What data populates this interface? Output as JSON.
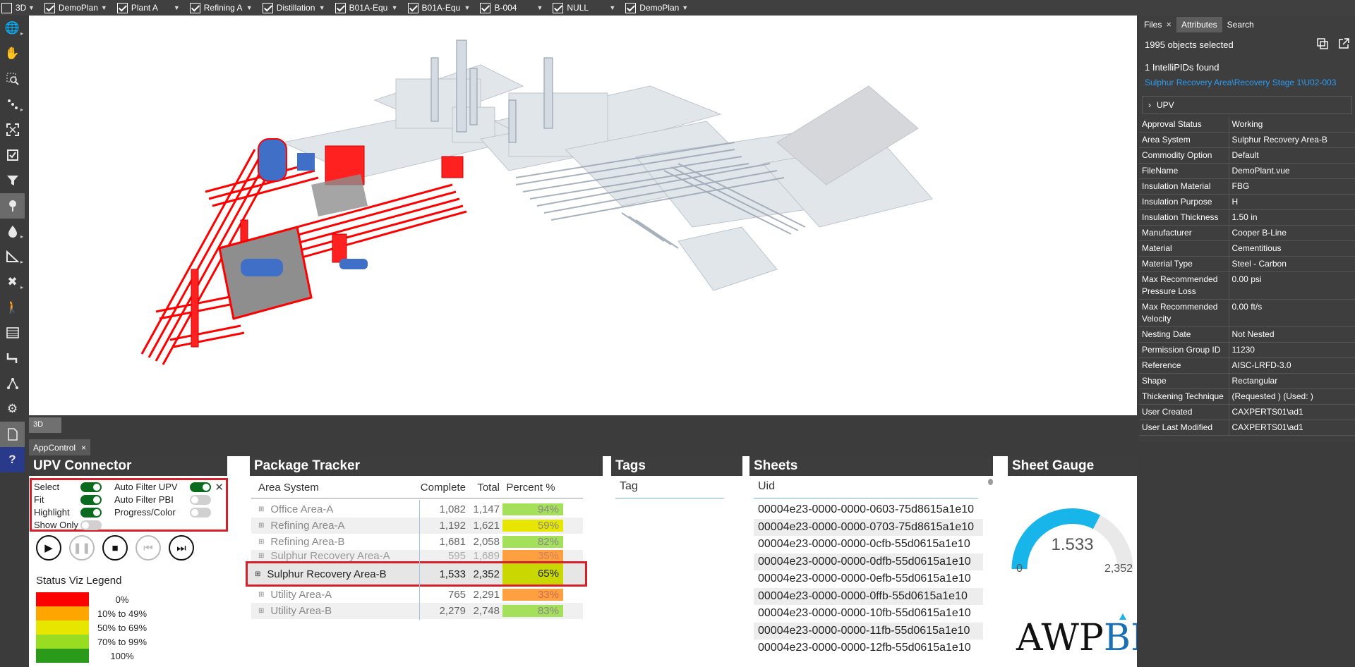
{
  "filters": [
    {
      "label": "3D",
      "checked": false
    },
    {
      "label": "DemoPlan",
      "checked": true
    },
    {
      "label": "Plant A",
      "checked": true
    },
    {
      "label": "Refining A",
      "checked": true
    },
    {
      "label": "Distillation",
      "checked": true
    },
    {
      "label": "B01A-Equ",
      "checked": true
    },
    {
      "label": "B01A-Equ",
      "checked": true
    },
    {
      "label": "B-004",
      "checked": true
    },
    {
      "label": "NULL",
      "checked": true
    },
    {
      "label": "DemoPlan",
      "checked": true
    }
  ],
  "toolbar": {
    "icons": [
      "globe-icon",
      "hand-pan-icon",
      "zoom-window-icon",
      "explode-icon",
      "fit-screen-icon",
      "checkbox-icon",
      "filter-icon",
      "pin-icon",
      "color-drop-icon",
      "measure-icon",
      "tools-icon",
      "walk-icon",
      "table-icon",
      "route-icon",
      "network-icon",
      "settings-icon",
      "document-icon",
      "help-icon"
    ],
    "help_label": "?"
  },
  "viewport": {
    "tab_label": "3D"
  },
  "right_panel": {
    "tabs": [
      {
        "label": "Files",
        "closable": true
      },
      {
        "label": "Attributes",
        "closable": false
      },
      {
        "label": "Search",
        "closable": false
      }
    ],
    "selected_text": "1995 objects selected",
    "found_text": "1  IntelliPIDs found",
    "path": "Sulphur Recovery Area\\Recovery Stage 1\\U02-003",
    "section_label": "UPV",
    "attributes": [
      {
        "name": "Approval Status",
        "value": "Working"
      },
      {
        "name": "Area System",
        "value": "Sulphur Recovery Area-B"
      },
      {
        "name": "Commodity Option",
        "value": "Default"
      },
      {
        "name": "FileName",
        "value": "DemoPlant.vue"
      },
      {
        "name": "Insulation Material",
        "value": "FBG"
      },
      {
        "name": "Insulation Purpose",
        "value": "H"
      },
      {
        "name": "Insulation Thickness",
        "value": "1.50 in"
      },
      {
        "name": "Manufacturer",
        "value": "Cooper B-Line"
      },
      {
        "name": "Material",
        "value": "Cementitious"
      },
      {
        "name": "Material Type",
        "value": "Steel - Carbon"
      },
      {
        "name": "Max Recommended Pressure Loss",
        "value": "0.00 psi"
      },
      {
        "name": "Max Recommended Velocity",
        "value": "0.00 ft/s"
      },
      {
        "name": "Nesting Date",
        "value": "Not Nested"
      },
      {
        "name": "Permission Group ID",
        "value": "11230"
      },
      {
        "name": "Reference",
        "value": "AISC-LRFD-3.0"
      },
      {
        "name": "Shape",
        "value": "Rectangular"
      },
      {
        "name": "Thickening Technique",
        "value": "(Requested ) (Used: )"
      },
      {
        "name": "User Created",
        "value": "CAXPERTS01\\ad1"
      },
      {
        "name": "User Last Modified",
        "value": "CAXPERTS01\\ad1"
      }
    ]
  },
  "app_control": {
    "tab_label": "AppControl"
  },
  "upv_connector": {
    "title": "UPV Connector",
    "toggles": [
      {
        "label": "Select",
        "on": true
      },
      {
        "label": "Fit",
        "on": true
      },
      {
        "label": "Highlight",
        "on": true
      },
      {
        "label": "Show Only",
        "on": false
      },
      {
        "label": "Auto Filter UPV",
        "on": true
      },
      {
        "label": "Auto Filter PBI",
        "on": false
      },
      {
        "label": "Progress/Color",
        "on": false
      }
    ],
    "legend_title": "Status Viz Legend",
    "legend": [
      {
        "label": "0%",
        "color": "#ff0000"
      },
      {
        "label": "10% to 49%",
        "color": "#ffa500"
      },
      {
        "label": "50% to 69%",
        "color": "#e6e600"
      },
      {
        "label": "70% to 99%",
        "color": "#99dd22"
      },
      {
        "label": "100%",
        "color": "#2a9a1a"
      }
    ]
  },
  "package_tracker": {
    "title": "Package Tracker",
    "columns": [
      "Area System",
      "Complete",
      "Total",
      "Percent %"
    ],
    "rows": [
      {
        "area": "Office Area-A",
        "complete": "1,082",
        "total": "1,147",
        "percent": "94%",
        "color": "#a5e05a"
      },
      {
        "area": "Refining Area-A",
        "complete": "1,192",
        "total": "1,621",
        "percent": "59%",
        "color": "#e6e600"
      },
      {
        "area": "Refining Area-B",
        "complete": "1,681",
        "total": "2,058",
        "percent": "82%",
        "color": "#a5e05a"
      },
      {
        "area": "Sulphur Recovery Area-A",
        "complete": "595",
        "total": "1,689",
        "percent": "35%",
        "color": "#ffa040"
      },
      {
        "area": "Sulphur Recovery Area-B",
        "complete": "1,533",
        "total": "2,352",
        "percent": "65%",
        "color": "#c8d800"
      },
      {
        "area": "Utility Area-A",
        "complete": "765",
        "total": "2,291",
        "percent": "33%",
        "color": "#ffa040"
      },
      {
        "area": "Utility Area-B",
        "complete": "2,279",
        "total": "2,748",
        "percent": "83%",
        "color": "#a5e05a"
      }
    ]
  },
  "tags": {
    "title": "Tags",
    "column": "Tag"
  },
  "sheets": {
    "title": "Sheets",
    "column": "Uid",
    "rows": [
      "00004e23-0000-0000-0603-75d8615a1e10",
      "00004e23-0000-0000-0703-75d8615a1e10",
      "00004e23-0000-0000-0cfb-55d0615a1e10",
      "00004e23-0000-0000-0dfb-55d0615a1e10",
      "00004e23-0000-0000-0efb-55d0615a1e10",
      "00004e23-0000-0000-0ffb-55d0615a1e10",
      "00004e23-0000-0000-10fb-55d0615a1e10",
      "00004e23-0000-0000-11fb-55d0615a1e10",
      "00004e23-0000-0000-12fb-55d0615a1e10"
    ]
  },
  "sheet_gauge": {
    "title": "Sheet Gauge",
    "value": "1.533",
    "min": "0",
    "max": "2,352",
    "fraction": 0.652,
    "logo_text": "AWP",
    "logo_accent": "BI",
    "color": "#17b5ea"
  }
}
